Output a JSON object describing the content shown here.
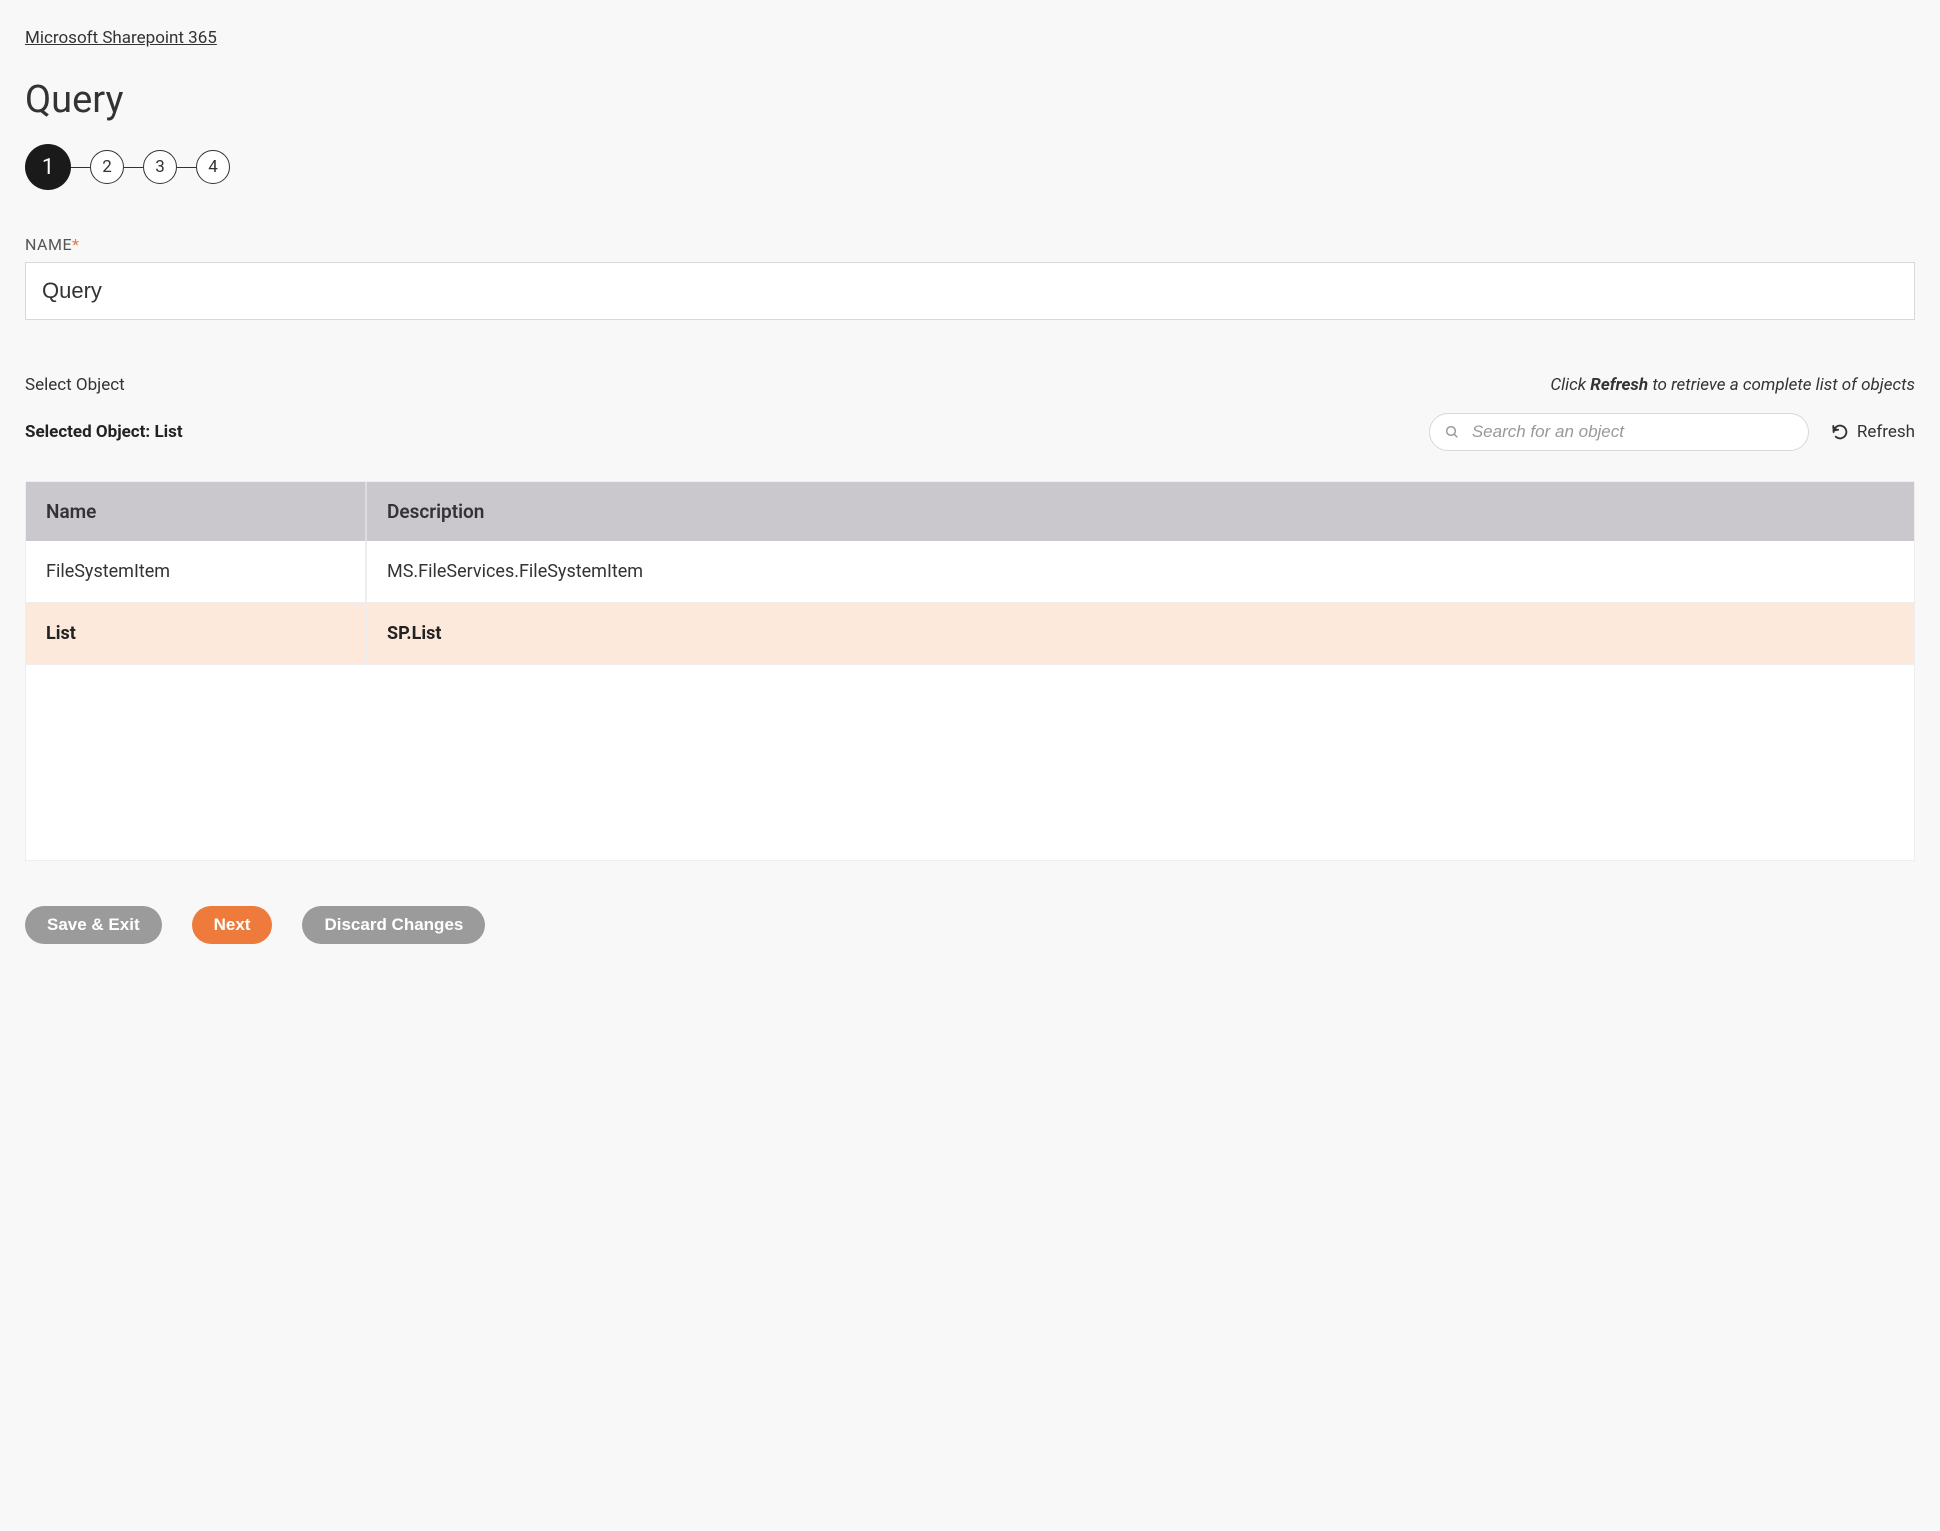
{
  "breadcrumb": {
    "label": "Microsoft Sharepoint 365"
  },
  "title": "Query",
  "stepper": {
    "steps": [
      "1",
      "2",
      "3",
      "4"
    ],
    "activeIndex": 0
  },
  "name_field": {
    "label": "NAME",
    "required_mark": "*",
    "value": "Query"
  },
  "select_object": {
    "label": "Select Object",
    "hint_prefix": "Click ",
    "hint_bold": "Refresh",
    "hint_suffix": " to retrieve a complete list of objects",
    "selected_prefix": "Selected Object: ",
    "selected_value": "List"
  },
  "search": {
    "placeholder": "Search for an object"
  },
  "refresh": {
    "label": "Refresh"
  },
  "table": {
    "headers": {
      "name": "Name",
      "description": "Description"
    },
    "rows": [
      {
        "name": "FileSystemItem",
        "description": "MS.FileServices.FileSystemItem",
        "selected": false
      },
      {
        "name": "List",
        "description": "SP.List",
        "selected": true
      }
    ]
  },
  "actions": {
    "save_exit": "Save & Exit",
    "next": "Next",
    "discard": "Discard Changes"
  }
}
